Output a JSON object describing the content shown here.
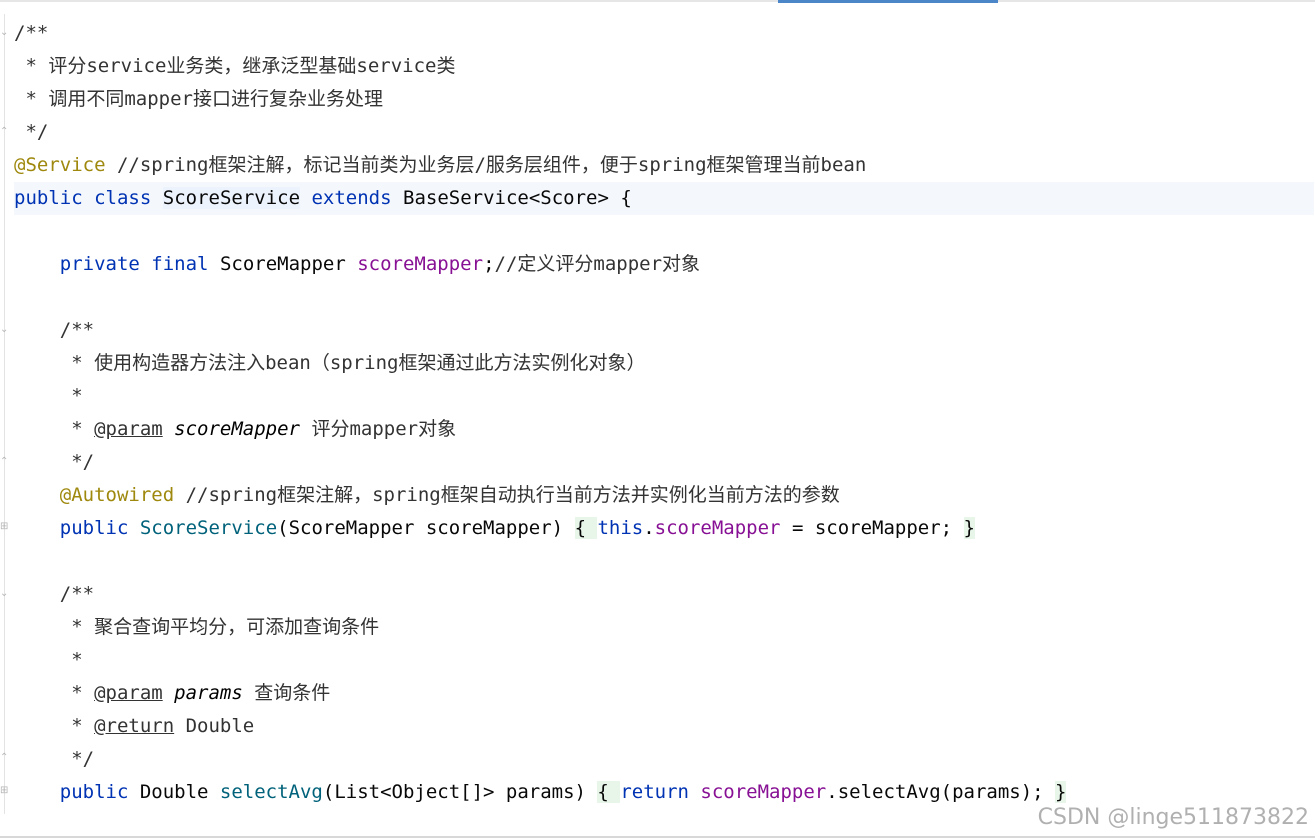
{
  "editor": {
    "lines": [
      {
        "parts": [
          {
            "t": "/**",
            "c": "cm"
          }
        ]
      },
      {
        "parts": [
          {
            "t": " * 评分service业务类，继承泛型基础service类",
            "c": "cm"
          }
        ]
      },
      {
        "parts": [
          {
            "t": " * 调用不同mapper接口进行复杂业务处理",
            "c": "cm"
          }
        ]
      },
      {
        "parts": [
          {
            "t": " */",
            "c": "cm"
          }
        ]
      },
      {
        "parts": [
          {
            "t": "@Service",
            "c": "ann"
          },
          {
            "t": " //spring框架注解，标记当前类为业务层/服务层组件，便于spring框架管理当前bean",
            "c": "cm"
          }
        ]
      },
      {
        "current": true,
        "parts": [
          {
            "t": "public",
            "c": "kw"
          },
          {
            "t": " "
          },
          {
            "t": "class",
            "c": "kw"
          },
          {
            "t": " "
          },
          {
            "t": "ScoreService",
            "c": "cls-hl"
          },
          {
            "t": " "
          },
          {
            "t": "extends",
            "c": "kw"
          },
          {
            "t": " BaseService<Score> {"
          }
        ]
      },
      {
        "parts": [
          {
            "t": ""
          }
        ]
      },
      {
        "parts": [
          {
            "t": "    "
          },
          {
            "t": "private",
            "c": "kw"
          },
          {
            "t": " "
          },
          {
            "t": "final",
            "c": "kw"
          },
          {
            "t": " ScoreMapper "
          },
          {
            "t": "scoreMapper",
            "c": "fld"
          },
          {
            "t": ";"
          },
          {
            "t": "//定义评分mapper对象",
            "c": "cm"
          }
        ]
      },
      {
        "parts": [
          {
            "t": ""
          }
        ]
      },
      {
        "parts": [
          {
            "t": "    /**",
            "c": "cm"
          }
        ]
      },
      {
        "parts": [
          {
            "t": "     * 使用构造器方法注入bean（spring框架通过此方法实例化对象）",
            "c": "cm"
          }
        ]
      },
      {
        "parts": [
          {
            "t": "     *",
            "c": "cm"
          }
        ]
      },
      {
        "parts": [
          {
            "t": "     * ",
            "c": "cm"
          },
          {
            "t": "@param",
            "c": "cm tag"
          },
          {
            "t": " "
          },
          {
            "t": "scoreMapper",
            "c": "param cm"
          },
          {
            "t": " 评分mapper对象",
            "c": "cm"
          }
        ]
      },
      {
        "parts": [
          {
            "t": "     */",
            "c": "cm"
          }
        ]
      },
      {
        "parts": [
          {
            "t": "    "
          },
          {
            "t": "@Autowired",
            "c": "ann"
          },
          {
            "t": " //spring框架注解，spring框架自动执行当前方法并实例化当前方法的参数",
            "c": "cm"
          }
        ]
      },
      {
        "parts": [
          {
            "t": "    "
          },
          {
            "t": "public",
            "c": "kw"
          },
          {
            "t": " "
          },
          {
            "t": "ScoreService",
            "c": "fn"
          },
          {
            "t": "(ScoreMapper scoreMapper) "
          },
          {
            "t": "{ ",
            "c": "brace-hl"
          },
          {
            "t": "this",
            "c": "kw"
          },
          {
            "t": "."
          },
          {
            "t": "scoreMapper",
            "c": "fld"
          },
          {
            "t": " = scoreMapper; "
          },
          {
            "t": "}",
            "c": "brace-hl"
          }
        ]
      },
      {
        "parts": [
          {
            "t": ""
          }
        ]
      },
      {
        "parts": [
          {
            "t": "    /**",
            "c": "cm"
          }
        ]
      },
      {
        "parts": [
          {
            "t": "     * 聚合查询平均分，可添加查询条件",
            "c": "cm"
          }
        ]
      },
      {
        "parts": [
          {
            "t": "     *",
            "c": "cm"
          }
        ]
      },
      {
        "parts": [
          {
            "t": "     * ",
            "c": "cm"
          },
          {
            "t": "@param",
            "c": "cm tag"
          },
          {
            "t": " "
          },
          {
            "t": "params",
            "c": "param cm"
          },
          {
            "t": " 查询条件",
            "c": "cm"
          }
        ]
      },
      {
        "parts": [
          {
            "t": "     * ",
            "c": "cm"
          },
          {
            "t": "@return",
            "c": "cm tag"
          },
          {
            "t": " Double",
            "c": "cm"
          }
        ]
      },
      {
        "parts": [
          {
            "t": "     */",
            "c": "cm"
          }
        ]
      },
      {
        "parts": [
          {
            "t": "    "
          },
          {
            "t": "public",
            "c": "kw"
          },
          {
            "t": " Double "
          },
          {
            "t": "selectAvg",
            "c": "fn"
          },
          {
            "t": "(List<Object[]> params) "
          },
          {
            "t": "{ ",
            "c": "brace-hl"
          },
          {
            "t": "return",
            "c": "kw"
          },
          {
            "t": " "
          },
          {
            "t": "scoreMapper",
            "c": "fld"
          },
          {
            "t": ".selectAvg(params); "
          },
          {
            "t": "}",
            "c": "brace-hl"
          }
        ]
      }
    ]
  },
  "watermark": "CSDN @linge511873822"
}
